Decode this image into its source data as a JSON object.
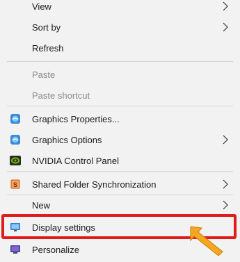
{
  "menu": {
    "items": [
      {
        "label": "View",
        "submenu": true,
        "disabled": false
      },
      {
        "label": "Sort by",
        "submenu": true,
        "disabled": false
      },
      {
        "label": "Refresh",
        "submenu": false,
        "disabled": false
      },
      {
        "label": "Paste",
        "submenu": false,
        "disabled": true
      },
      {
        "label": "Paste shortcut",
        "submenu": false,
        "disabled": true
      },
      {
        "label": "Graphics Properties...",
        "submenu": false,
        "disabled": false,
        "icon": "intel-graphics-icon"
      },
      {
        "label": "Graphics Options",
        "submenu": true,
        "disabled": false,
        "icon": "intel-graphics-icon"
      },
      {
        "label": "NVIDIA Control Panel",
        "submenu": false,
        "disabled": false,
        "icon": "nvidia-icon"
      },
      {
        "label": "Shared Folder Synchronization",
        "submenu": true,
        "disabled": false,
        "icon": "shared-folder-sync-icon"
      },
      {
        "label": "New",
        "submenu": true,
        "disabled": false
      },
      {
        "label": "Display settings",
        "submenu": false,
        "disabled": false,
        "icon": "display-icon",
        "highlighted": true
      },
      {
        "label": "Personalize",
        "submenu": false,
        "disabled": false,
        "icon": "personalize-icon"
      }
    ]
  },
  "colors": {
    "menu_bg": "#f2f2f2",
    "highlight_border": "#e01b1b",
    "cursor_fill": "#f5a623",
    "disabled_text": "#8a8a8a"
  }
}
